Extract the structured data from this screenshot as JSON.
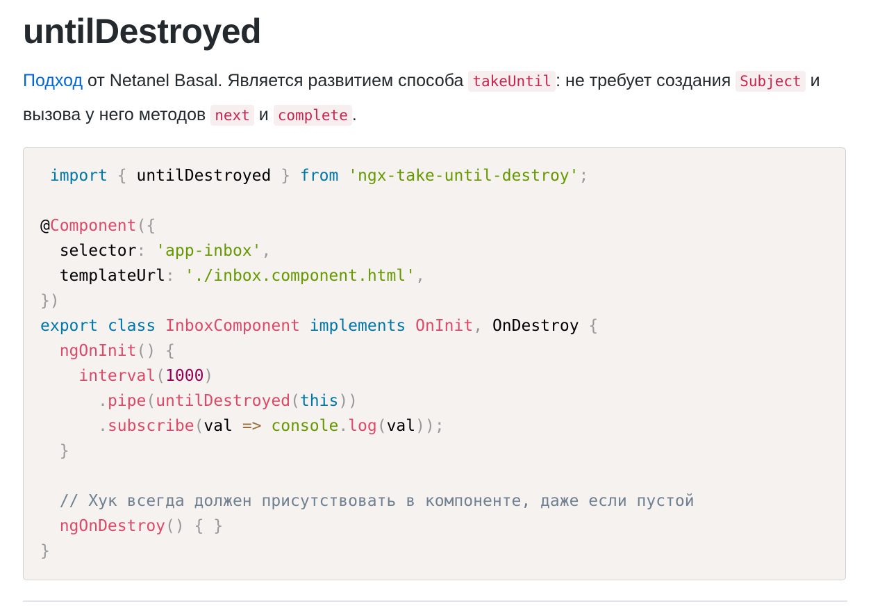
{
  "heading": "untilDestroyed",
  "intro": {
    "link": "Подход",
    "t1": " от Netanel Basal. Является развитием способа ",
    "code1": "takeUntil",
    "t2": ": не требует создания ",
    "code2": "Subject",
    "t3": " и вызова у него методов ",
    "code3": "next",
    "t4": " и ",
    "code4": "complete",
    "t5": "."
  },
  "code": [
    [
      {
        "t": " import",
        "c": "kw"
      },
      {
        "t": " { ",
        "c": "punct"
      },
      {
        "t": "untilDestroyed",
        "c": "plain"
      },
      {
        "t": " } ",
        "c": "punct"
      },
      {
        "t": "from",
        "c": "kw"
      },
      {
        "t": " ",
        "c": "plain"
      },
      {
        "t": "'ngx-take-until-destroy'",
        "c": "str"
      },
      {
        "t": ";",
        "c": "punct"
      }
    ],
    [],
    [
      {
        "t": "@",
        "c": "plain"
      },
      {
        "t": "Component",
        "c": "fn"
      },
      {
        "t": "({",
        "c": "punct"
      }
    ],
    [
      {
        "t": "  selector",
        "c": "plain"
      },
      {
        "t": ": ",
        "c": "punct"
      },
      {
        "t": "'app-inbox'",
        "c": "str"
      },
      {
        "t": ",",
        "c": "punct"
      }
    ],
    [
      {
        "t": "  templateUrl",
        "c": "plain"
      },
      {
        "t": ": ",
        "c": "punct"
      },
      {
        "t": "'./inbox.component.html'",
        "c": "str"
      },
      {
        "t": ",",
        "c": "punct"
      }
    ],
    [
      {
        "t": "})",
        "c": "punct"
      }
    ],
    [
      {
        "t": "export",
        "c": "kw"
      },
      {
        "t": " ",
        "c": "plain"
      },
      {
        "t": "class",
        "c": "kw"
      },
      {
        "t": " ",
        "c": "plain"
      },
      {
        "t": "InboxComponent",
        "c": "fn"
      },
      {
        "t": " ",
        "c": "plain"
      },
      {
        "t": "implements",
        "c": "kw"
      },
      {
        "t": " ",
        "c": "plain"
      },
      {
        "t": "OnInit",
        "c": "fn"
      },
      {
        "t": ", ",
        "c": "punct"
      },
      {
        "t": "OnDestroy",
        "c": "plain"
      },
      {
        "t": " {",
        "c": "punct"
      }
    ],
    [
      {
        "t": "  ngOnInit",
        "c": "fn"
      },
      {
        "t": "() {",
        "c": "punct"
      }
    ],
    [
      {
        "t": "    interval",
        "c": "fn"
      },
      {
        "t": "(",
        "c": "punct"
      },
      {
        "t": "1000",
        "c": "num"
      },
      {
        "t": ")",
        "c": "punct"
      }
    ],
    [
      {
        "t": "      .",
        "c": "punct"
      },
      {
        "t": "pipe",
        "c": "fn"
      },
      {
        "t": "(",
        "c": "punct"
      },
      {
        "t": "untilDestroyed",
        "c": "fn"
      },
      {
        "t": "(",
        "c": "punct"
      },
      {
        "t": "this",
        "c": "kw"
      },
      {
        "t": "))",
        "c": "punct"
      }
    ],
    [
      {
        "t": "      .",
        "c": "punct"
      },
      {
        "t": "subscribe",
        "c": "fn"
      },
      {
        "t": "(",
        "c": "punct"
      },
      {
        "t": "val ",
        "c": "plain"
      },
      {
        "t": "=>",
        "c": "op"
      },
      {
        "t": " ",
        "c": "plain"
      },
      {
        "t": "console",
        "c": "str"
      },
      {
        "t": ".",
        "c": "punct"
      },
      {
        "t": "log",
        "c": "fn"
      },
      {
        "t": "(",
        "c": "punct"
      },
      {
        "t": "val",
        "c": "plain"
      },
      {
        "t": "));",
        "c": "punct"
      }
    ],
    [
      {
        "t": "  }",
        "c": "punct"
      }
    ],
    [],
    [
      {
        "t": "  // Хук всегда должен присутствовать в компоненте, даже если пустой",
        "c": "comment"
      }
    ],
    [
      {
        "t": "  ngOnDestroy",
        "c": "fn"
      },
      {
        "t": "() { }",
        "c": "punct"
      }
    ],
    [
      {
        "t": "}",
        "c": "punct"
      }
    ]
  ]
}
